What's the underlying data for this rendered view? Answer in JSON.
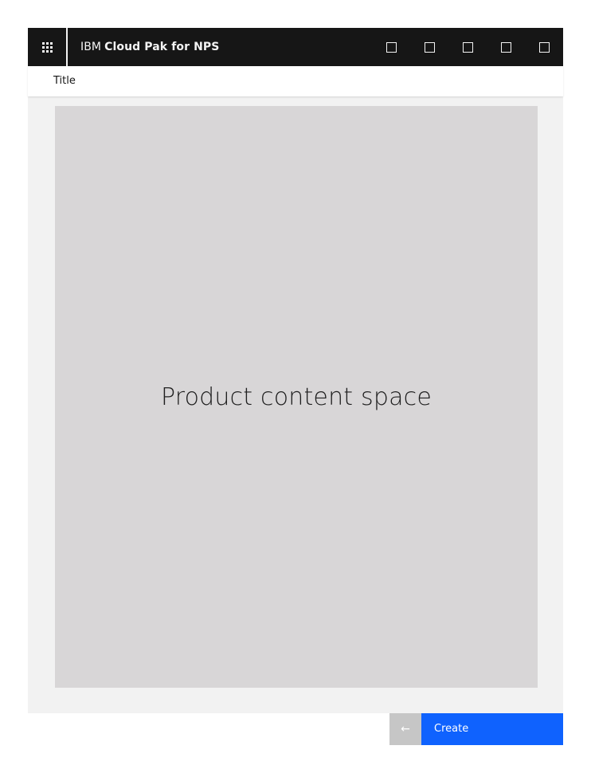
{
  "header": {
    "brand_prefix": "IBM",
    "product_name": "Cloud Pak for NPS",
    "switcher_icon": "app-switcher-grid-icon",
    "actions": [
      {
        "icon": "square-icon"
      },
      {
        "icon": "square-icon"
      },
      {
        "icon": "square-icon"
      },
      {
        "icon": "square-icon"
      },
      {
        "icon": "square-icon"
      }
    ]
  },
  "titlebar": {
    "title": "Title"
  },
  "main": {
    "placeholder": "Product content space"
  },
  "footer": {
    "back_icon": "arrow-left-icon",
    "back_glyph": "←",
    "create_label": "Create"
  },
  "colors": {
    "header_bg": "#161616",
    "main_bg": "#f2f2f2",
    "content_bg": "#d8d6d7",
    "primary": "#0f62fe",
    "disabled": "#c6c6c6"
  }
}
